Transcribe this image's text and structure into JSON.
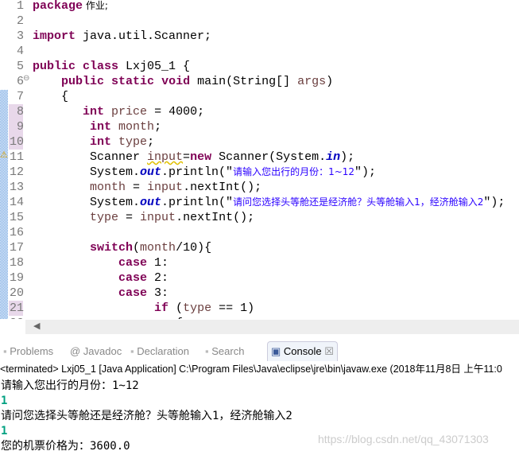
{
  "editor": {
    "lines": [
      [
        [
          "package",
          "kw"
        ],
        [
          " 作业;",
          "cn"
        ]
      ],
      [],
      [
        [
          "import",
          "kw"
        ],
        [
          " java.util.Scanner;",
          ""
        ]
      ],
      [],
      [
        [
          "public",
          "kw"
        ],
        [
          " ",
          ""
        ],
        [
          "class",
          "kw"
        ],
        [
          " Lxj05_1 {",
          ""
        ]
      ],
      [
        [
          "    ",
          ""
        ],
        [
          "public",
          "kw"
        ],
        [
          " ",
          ""
        ],
        [
          "static",
          "kw"
        ],
        [
          " ",
          ""
        ],
        [
          "void",
          "kw"
        ],
        [
          " main(String[] ",
          ""
        ],
        [
          "args",
          "var"
        ],
        [
          ")",
          ""
        ]
      ],
      [
        [
          "    {",
          ""
        ]
      ],
      [
        [
          "       ",
          ""
        ],
        [
          "int",
          "kw"
        ],
        [
          " ",
          ""
        ],
        [
          "price",
          "var"
        ],
        [
          " = 4000;",
          ""
        ]
      ],
      [
        [
          "        ",
          ""
        ],
        [
          "int",
          "kw"
        ],
        [
          " ",
          ""
        ],
        [
          "month",
          "var"
        ],
        [
          ";",
          ""
        ]
      ],
      [
        [
          "        ",
          ""
        ],
        [
          "int",
          "kw"
        ],
        [
          " ",
          ""
        ],
        [
          "type",
          "var"
        ],
        [
          ";",
          ""
        ]
      ],
      [
        [
          "        Scanner ",
          ""
        ],
        [
          "input",
          "var warn"
        ],
        [
          "=",
          ""
        ],
        [
          "new",
          "kw"
        ],
        [
          " Scanner(System.",
          ""
        ],
        [
          "in",
          "fld"
        ],
        [
          ");",
          ""
        ]
      ],
      [
        [
          "        System.",
          ""
        ],
        [
          "out",
          "fld"
        ],
        [
          ".println(\"",
          ""
        ],
        [
          "请输入您出行的月份：1~12",
          "str cn"
        ],
        [
          "\");",
          ""
        ]
      ],
      [
        [
          "        ",
          ""
        ],
        [
          "month",
          "var"
        ],
        [
          " = ",
          ""
        ],
        [
          "input",
          "var"
        ],
        [
          ".nextInt();",
          ""
        ]
      ],
      [
        [
          "        System.",
          ""
        ],
        [
          "out",
          "fld"
        ],
        [
          ".println(\"",
          ""
        ],
        [
          "请问您选择头等舱还是经济舱？头等舱输入1，经济舱输入2",
          "str cn"
        ],
        [
          "\");",
          ""
        ]
      ],
      [
        [
          "        ",
          ""
        ],
        [
          "type",
          "var"
        ],
        [
          " = ",
          ""
        ],
        [
          "input",
          "var"
        ],
        [
          ".nextInt();",
          ""
        ]
      ],
      [],
      [
        [
          "        ",
          ""
        ],
        [
          "switch",
          "kw"
        ],
        [
          "(",
          ""
        ],
        [
          "month",
          "var"
        ],
        [
          "/10){",
          ""
        ]
      ],
      [
        [
          "            ",
          ""
        ],
        [
          "case",
          "kw"
        ],
        [
          " 1:",
          ""
        ]
      ],
      [
        [
          "            ",
          ""
        ],
        [
          "case",
          "kw"
        ],
        [
          " 2:",
          ""
        ]
      ],
      [
        [
          "            ",
          ""
        ],
        [
          "case",
          "kw"
        ],
        [
          " 3:",
          ""
        ]
      ],
      [
        [
          "                 ",
          ""
        ],
        [
          "if",
          "kw"
        ],
        [
          " (",
          ""
        ],
        [
          "type",
          "var"
        ],
        [
          " == 1)",
          ""
        ]
      ],
      [
        [
          "                    {",
          ""
        ]
      ]
    ]
  },
  "tabs": [
    {
      "label": "Problems",
      "icon": "problems-icon"
    },
    {
      "label": "@ Javadoc",
      "icon": "javadoc-icon"
    },
    {
      "label": "Declaration",
      "icon": "declaration-icon"
    },
    {
      "label": "Search",
      "icon": "search-icon"
    },
    {
      "label": "Console",
      "icon": "console-icon",
      "active": true
    }
  ],
  "console": {
    "status": "<terminated> Lxj05_1 [Java Application] C:\\Program Files\\Java\\eclipse\\jre\\bin\\javaw.exe (2018年11月8日 上午11:0",
    "lines": [
      {
        "text": "请输入您出行的月份：1~12",
        "input": false
      },
      {
        "text": "1",
        "input": true
      },
      {
        "text": "请问您选择头等舱还是经济舱？头等舱输入1，经济舱输入2",
        "input": false
      },
      {
        "text": "1",
        "input": true
      },
      {
        "text": "您的机票价格为：3600.0",
        "input": false
      }
    ]
  },
  "watermark": "https://blog.csdn.net/qq_43071303"
}
